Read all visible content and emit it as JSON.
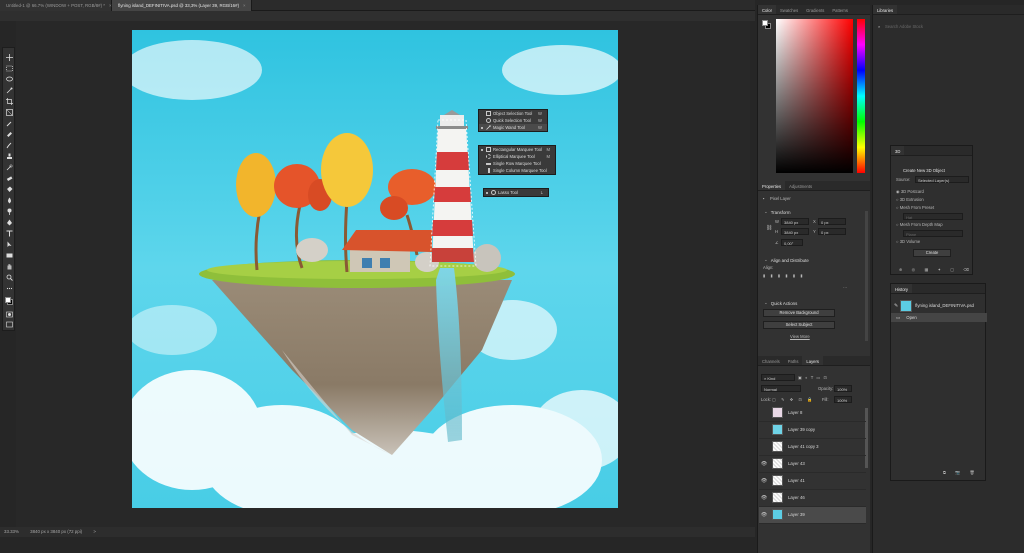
{
  "tabs": [
    {
      "label": "Untitled-1 @ 66.7% (WINDOW + POST, RGB/8#) *",
      "close": "×"
    },
    {
      "label": "flyning island_DEFINITIVA.psd @ 33,3% (Layer 39, RGB/16#)",
      "close": "×"
    }
  ],
  "flyout_select": [
    {
      "label": "Object Selection Tool",
      "key": "W"
    },
    {
      "label": "Quick Selection Tool",
      "key": "W"
    },
    {
      "label": "Magic Wand Tool",
      "key": "W"
    }
  ],
  "flyout_marquee": [
    {
      "label": "Rectangular Marquee Tool",
      "key": "M"
    },
    {
      "label": "Elliptical Marquee Tool",
      "key": "M"
    },
    {
      "label": "Single Row Marquee Tool",
      "key": ""
    },
    {
      "label": "Single Column Marquee Tool",
      "key": ""
    }
  ],
  "flyout_lasso": {
    "label": "Lasso Tool",
    "key": "L"
  },
  "status": {
    "zoom": "33.33%",
    "info": "3840 px x 3840 px (72 ppi)",
    "arrow": ">"
  },
  "color_panel": {
    "tabs": [
      "Color",
      "Swatches",
      "Gradients",
      "Patterns"
    ],
    "accent": "#ff0000"
  },
  "properties": {
    "tabs": [
      "Properties",
      "Adjustments"
    ],
    "kind": "Pixel Layer",
    "transform_title": "Transform",
    "w_label": "W",
    "w_value": "3840 px",
    "h_label": "H",
    "h_value": "3840 px",
    "x_label": "X",
    "x_value": "0 px",
    "y_label": "Y",
    "y_value": "0 px",
    "angle_value": "0,00°",
    "align_title": "Align and Distribute",
    "align_label": "Align:",
    "quick_title": "Quick Actions",
    "remove_bg": "Remove Background",
    "select_subject": "Select Subject",
    "view_more": "View More"
  },
  "layers_panel": {
    "tabs": [
      "Channels",
      "Paths",
      "Layers"
    ],
    "kind_filter": "Kind",
    "blend_mode": "Normal",
    "opacity_label": "Opacity:",
    "opacity_value": "100%",
    "lock_label": "Lock:",
    "fill_label": "Fill:",
    "fill_value": "100%",
    "layers": [
      {
        "name": "Layer 8",
        "visible": false,
        "selected": false
      },
      {
        "name": "Layer 39 copy",
        "visible": false,
        "selected": false
      },
      {
        "name": "Layer 41 copy 3",
        "visible": false,
        "selected": false
      },
      {
        "name": "Layer 43",
        "visible": true,
        "selected": false
      },
      {
        "name": "Layer 41",
        "visible": true,
        "selected": false
      },
      {
        "name": "Layer 46",
        "visible": true,
        "selected": false
      },
      {
        "name": "Layer 39",
        "visible": true,
        "selected": true
      }
    ]
  },
  "libraries": {
    "tab": "Libraries",
    "search_placeholder": "Search Adobe Stock"
  },
  "panel_3d": {
    "tab": "3D",
    "title": "Create New 3D Object",
    "source_label": "Source:",
    "source_value": "Selected Layer(s)",
    "options": [
      "3D Postcard",
      "3D Extrusion",
      "Mesh From Preset",
      "Mesh From Depth Map",
      "3D Volume"
    ],
    "preset": "Hat",
    "depth": "Plane",
    "create": "Create"
  },
  "history": {
    "tab": "History",
    "snapshot": "flyning island_DEFINITIVA.psd",
    "step": "Open"
  }
}
